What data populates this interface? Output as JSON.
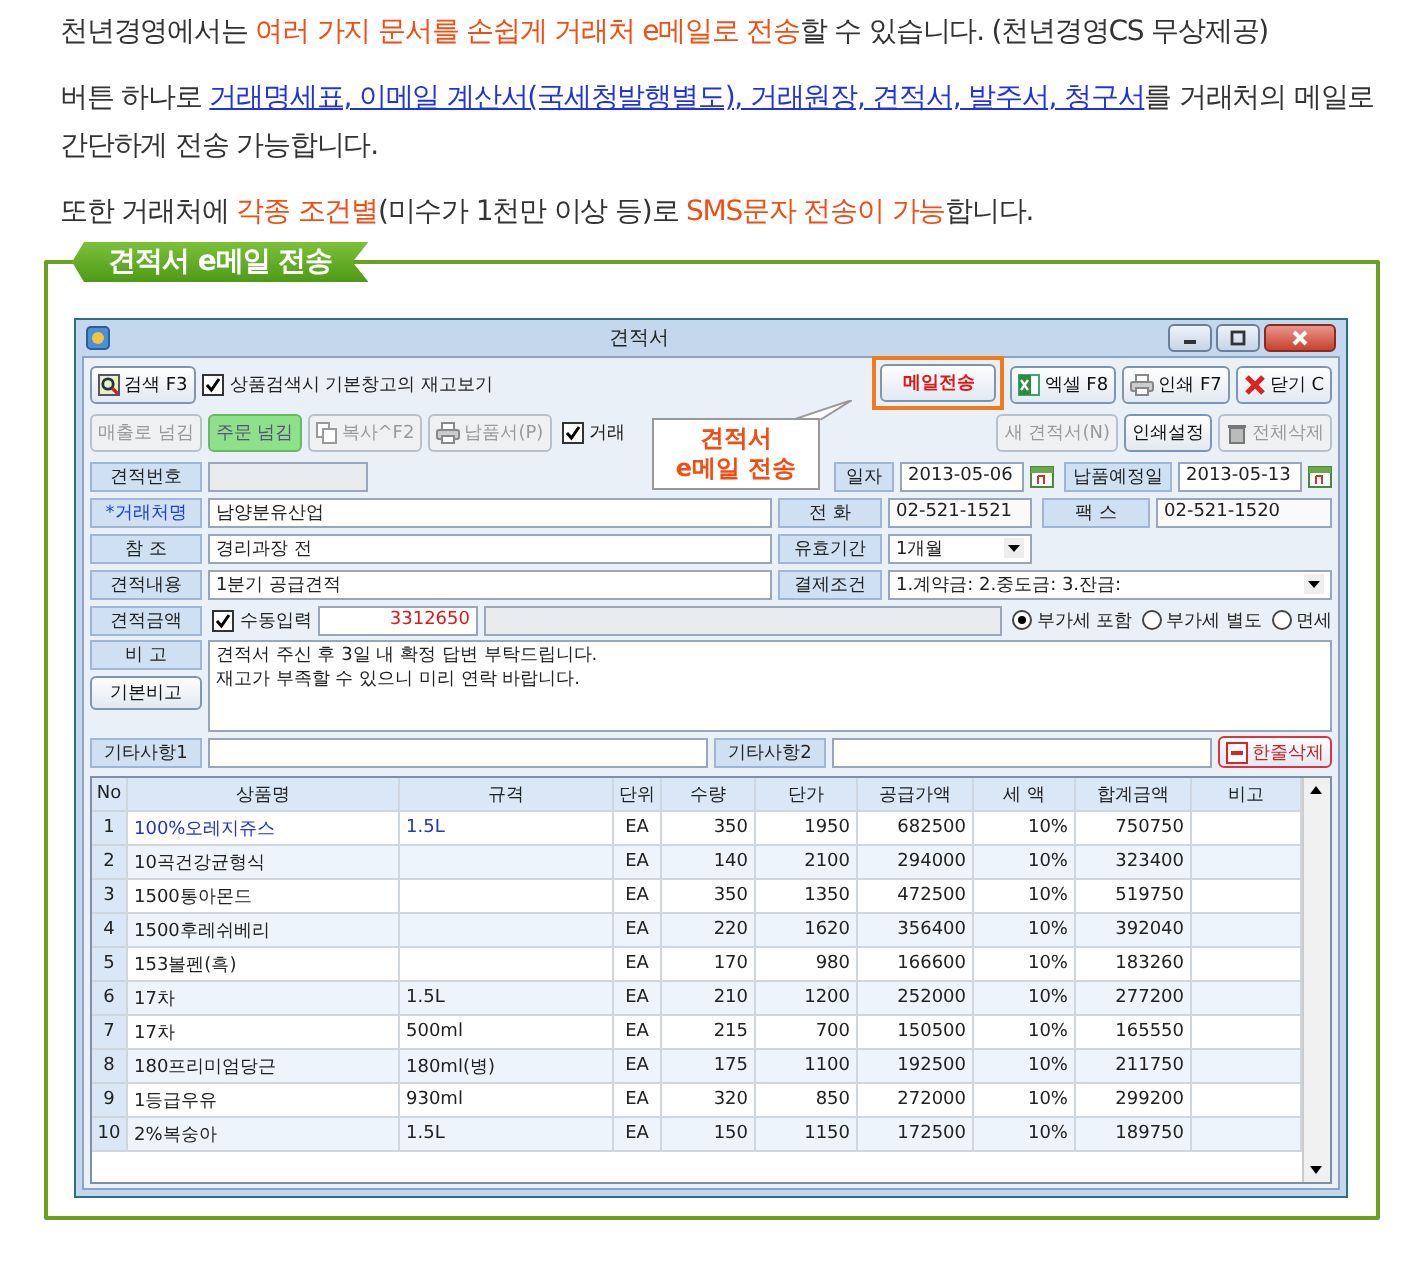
{
  "intro": [
    {
      "segments": [
        {
          "kind": "plain",
          "text": "천년경영에서는 "
        },
        {
          "kind": "highlight",
          "text": "여러 가지 문서를 손쉽게 거래처 e메일로 전송"
        },
        {
          "kind": "plain",
          "text": "할 수 있습니다. (천년경영CS 무상제공)"
        }
      ]
    },
    {
      "segments": [
        {
          "kind": "plain",
          "text": "버튼 하나로 "
        },
        {
          "kind": "link",
          "text": "거래명세표, 이메일 계산서(국세청발행별도), 거래원장, 견적서, 발주서, 청구서"
        },
        {
          "kind": "plain",
          "text": "를 거래처의 메일로 간단하게 전송 가능합니다."
        }
      ]
    },
    {
      "segments": [
        {
          "kind": "plain",
          "text": "또한 거래처에 "
        },
        {
          "kind": "highlight",
          "text": "각종 조건별"
        },
        {
          "kind": "plain",
          "text": "(미수가 1천만 이상 등)로 "
        },
        {
          "kind": "highlight",
          "text": "SMS문자 전송이 가능"
        },
        {
          "kind": "plain",
          "text": "합니다."
        }
      ]
    }
  ],
  "section_title": "견적서 e메일 전송",
  "window": {
    "title": "견적서",
    "callout": [
      "견적서",
      "e메일 전송"
    ],
    "toolbar_top": {
      "left": [
        {
          "label": "검색 F3",
          "kind": "normal",
          "highlighted": false
        }
      ],
      "option": {
        "label": "상품검색시 기본창고의 재고보기",
        "checked": true
      },
      "right": [
        {
          "label": "메일전송",
          "kind": "red",
          "highlighted": true
        },
        {
          "label": "엑셀 F8",
          "kind": "normal",
          "highlighted": false
        },
        {
          "label": "인쇄 F7",
          "kind": "normal",
          "highlighted": false
        },
        {
          "label": "닫기 C",
          "kind": "normal",
          "highlighted": false
        }
      ]
    },
    "toolbar_second": {
      "left": [
        {
          "label": "매출로 넘김",
          "kind": "disabled",
          "highlighted": false
        },
        {
          "label": "주문 넘김",
          "kind": "green",
          "highlighted": false
        },
        {
          "label": "복사^F2",
          "kind": "disabled",
          "highlighted": false
        },
        {
          "label": "납품서(P)",
          "kind": "disabled",
          "highlighted": false
        }
      ],
      "option": {
        "label": "거래",
        "checked": true
      },
      "right": [
        {
          "label": "새 견적서(N)",
          "kind": "disabled",
          "highlighted": false
        },
        {
          "label": "인쇄설정",
          "kind": "normal",
          "highlighted": false
        },
        {
          "label": "전체삭제",
          "kind": "disabled",
          "highlighted": false
        }
      ]
    },
    "form": {
      "quote_no": {
        "label": "견적번호"
      },
      "quote_date": {
        "label": "일자",
        "value": "2013-05-06"
      },
      "due_date": {
        "label": "납품예정일",
        "value": "2013-05-13"
      },
      "client": {
        "label": "*거래처명",
        "value": "남양분유산업",
        "required": true
      },
      "phone": {
        "label": "전 화",
        "value": "02-521-1521"
      },
      "fax": {
        "label": "팩 스",
        "value": "02-521-1520"
      },
      "reference": {
        "label": "참 조",
        "value": "경리과장 전"
      },
      "validity": {
        "label": "유효기간",
        "value": "1개월"
      },
      "content": {
        "label": "견적내용",
        "value": "1분기 공급견적"
      },
      "payment": {
        "label": "결제조건",
        "value": "1.계약금: 2.중도금: 3.잔금:"
      },
      "amount": {
        "label": "견적금액",
        "manual": {
          "label": "수동입력",
          "checked": true
        },
        "value": "3312650"
      },
      "vat": [
        {
          "label": "부가세 포함",
          "selected": true
        },
        {
          "label": "부가세 별도",
          "selected": false
        },
        {
          "label": "면세",
          "selected": false
        }
      ],
      "note": {
        "label": "비 고",
        "default_button": "기본비고",
        "lines": [
          "견적서 주신 후 3일 내 확정 답변 부탁드립니다.",
          "재고가 부족할 수 있으니 미리 연락 바랍니다."
        ]
      },
      "extra1": {
        "label": "기타사항1"
      },
      "extra2": {
        "label": "기타사항2"
      },
      "delete_row_button": "한줄삭제"
    },
    "table": {
      "columns": [
        "No",
        "상품명",
        "규격",
        "단위",
        "수량",
        "단가",
        "공급가액",
        "세 액",
        "합계금액",
        "비고"
      ],
      "rows": [
        {
          "no": "1",
          "product": "100%오레지쥬스",
          "spec": "1.5L",
          "unit": "EA",
          "qty": "350",
          "price": "1950",
          "supply": "682500",
          "tax": "10%",
          "total": "750750",
          "selected": true
        },
        {
          "no": "2",
          "product": "10곡건강균형식",
          "unit": "EA",
          "qty": "140",
          "price": "2100",
          "supply": "294000",
          "tax": "10%",
          "total": "323400",
          "selected": false
        },
        {
          "no": "3",
          "product": "1500통아몬드",
          "unit": "EA",
          "qty": "350",
          "price": "1350",
          "supply": "472500",
          "tax": "10%",
          "total": "519750",
          "selected": false
        },
        {
          "no": "4",
          "product": "1500후레쉬베리",
          "unit": "EA",
          "qty": "220",
          "price": "1620",
          "supply": "356400",
          "tax": "10%",
          "total": "392040",
          "selected": false
        },
        {
          "no": "5",
          "product": "153볼펜(흑)",
          "unit": "EA",
          "qty": "170",
          "price": "980",
          "supply": "166600",
          "tax": "10%",
          "total": "183260",
          "selected": false
        },
        {
          "no": "6",
          "product": "17차",
          "spec": "1.5L",
          "unit": "EA",
          "qty": "210",
          "price": "1200",
          "supply": "252000",
          "tax": "10%",
          "total": "277200",
          "selected": false
        },
        {
          "no": "7",
          "product": "17차",
          "spec": "500ml",
          "unit": "EA",
          "qty": "215",
          "price": "700",
          "supply": "150500",
          "tax": "10%",
          "total": "165550",
          "selected": false
        },
        {
          "no": "8",
          "product": "180프리미엄당근",
          "spec": "180ml(병)",
          "unit": "EA",
          "qty": "175",
          "price": "1100",
          "supply": "192500",
          "tax": "10%",
          "total": "211750",
          "selected": false
        },
        {
          "no": "9",
          "product": "1등급우유",
          "spec": "930ml",
          "unit": "EA",
          "qty": "320",
          "price": "850",
          "supply": "272000",
          "tax": "10%",
          "total": "299200",
          "selected": false
        },
        {
          "no": "10",
          "product": "2%복숭아",
          "spec": "1.5L",
          "unit": "EA",
          "qty": "150",
          "price": "1150",
          "supply": "172500",
          "tax": "10%",
          "total": "189750",
          "selected": false
        }
      ]
    }
  }
}
